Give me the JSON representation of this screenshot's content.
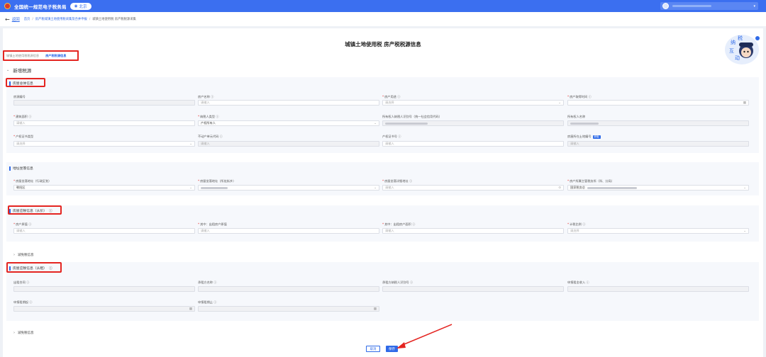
{
  "topbar": {
    "title": "全国统一规范电子税务局",
    "city": "北京"
  },
  "breadcrumb": {
    "back": "返回",
    "home": "首页",
    "level2": "房产税城镇土地使用税采集及合并申报",
    "current": "城镇土地使用税 房产税税源采集"
  },
  "page_title": "城镇土地使用税 房产税税源信息",
  "mascot_text": "纳税互动",
  "tabs": [
    {
      "label": "城镇土地使用税税源信息",
      "active": false
    },
    {
      "label": "房产税税源信息",
      "active": true
    }
  ],
  "section_title": "新增税源",
  "group1": {
    "title": "房屋总体信息",
    "fields": [
      {
        "label": "房源编号",
        "required": false,
        "help": false,
        "placeholder": "",
        "disabled": true,
        "icon": ""
      },
      {
        "label": "房产名称",
        "required": false,
        "help": true,
        "placeholder": "请输入",
        "disabled": false,
        "icon": ""
      },
      {
        "label": "房产用途",
        "required": true,
        "help": true,
        "placeholder": "请选择",
        "disabled": false,
        "icon": "chevron-down-icon"
      },
      {
        "label": "房产取得时间",
        "required": true,
        "help": true,
        "placeholder": "",
        "disabled": false,
        "icon": "calendar-icon"
      },
      {
        "label": "建筑面积",
        "required": true,
        "help": true,
        "placeholder": "请输入",
        "disabled": false,
        "icon": ""
      },
      {
        "label": "纳税人类型",
        "required": true,
        "help": true,
        "placeholder": "产权所有人",
        "disabled": false,
        "icon": "chevron-down-icon"
      },
      {
        "label": "所有权人纳税人识别号（统一社会信用代码）",
        "required": false,
        "help": false,
        "placeholder": "",
        "disabled": true,
        "icon": ""
      },
      {
        "label": "所有权人名称",
        "required": false,
        "help": false,
        "placeholder": "",
        "disabled": true,
        "icon": ""
      },
      {
        "label": "产权证书类型",
        "required": true,
        "help": false,
        "placeholder": "请选择",
        "disabled": false,
        "icon": "chevron-down-icon"
      },
      {
        "label": "不动产单元代码",
        "required": false,
        "help": true,
        "placeholder": "请输入",
        "disabled": true,
        "icon": ""
      },
      {
        "label": "产权证书号",
        "required": false,
        "help": true,
        "placeholder": "请输入",
        "disabled": false,
        "icon": ""
      },
      {
        "label": "房屋所在土地编号",
        "required": false,
        "help": false,
        "placeholder": "请输入",
        "disabled": false,
        "icon": "",
        "badge": "获取"
      }
    ]
  },
  "group2": {
    "title": "地址坐落信息",
    "fields": [
      {
        "label": "房屋坐落地址（行政区划）",
        "required": true,
        "help": false,
        "value": "朝阳区",
        "disabled": false,
        "icon": "chevron-down-icon"
      },
      {
        "label": "房屋坐落地址（所处街乡）",
        "required": true,
        "help": false,
        "value": "",
        "disabled": false,
        "icon": "chevron-down-icon"
      },
      {
        "label": "房屋坐落详细地址",
        "required": true,
        "help": true,
        "placeholder": "请输入",
        "disabled": false,
        "icon": "location-icon"
      },
      {
        "label": "房产所属主管税务所（科、分局）",
        "required": true,
        "help": false,
        "value": "国家税务总",
        "disabled": false,
        "icon": "chevron-down-icon"
      }
    ]
  },
  "group3": {
    "title": "房屋应税信息（从价）",
    "fields": [
      {
        "label": "房产原值",
        "required": true,
        "help": true,
        "placeholder": "请输入"
      },
      {
        "label": "其中：出租房产原值",
        "required": true,
        "help": false,
        "placeholder": "请输入"
      },
      {
        "label": "其中：出租房产面积",
        "required": true,
        "help": true,
        "placeholder": "请输入"
      },
      {
        "label": "计税比例",
        "required": true,
        "help": true,
        "placeholder": "请选择",
        "icon": "chevron-down-icon"
      }
    ],
    "collapse_label": "减免税信息"
  },
  "group4": {
    "title": "房屋应税信息（从租）",
    "fields": [
      {
        "label": "出租合同",
        "help": true,
        "icon": ""
      },
      {
        "label": "承租方名称",
        "help": true,
        "icon": ""
      },
      {
        "label": "承租方纳税人识别号",
        "help": true,
        "icon": ""
      },
      {
        "label": "申报租金收入",
        "help": true,
        "icon": ""
      },
      {
        "label": "申报租期起",
        "help": true,
        "icon": "calendar-icon"
      },
      {
        "label": "申报租期止",
        "help": true,
        "icon": "calendar-icon"
      }
    ],
    "collapse_label": "减免税信息"
  },
  "buttons": {
    "cancel": "取消",
    "save": "保存"
  }
}
